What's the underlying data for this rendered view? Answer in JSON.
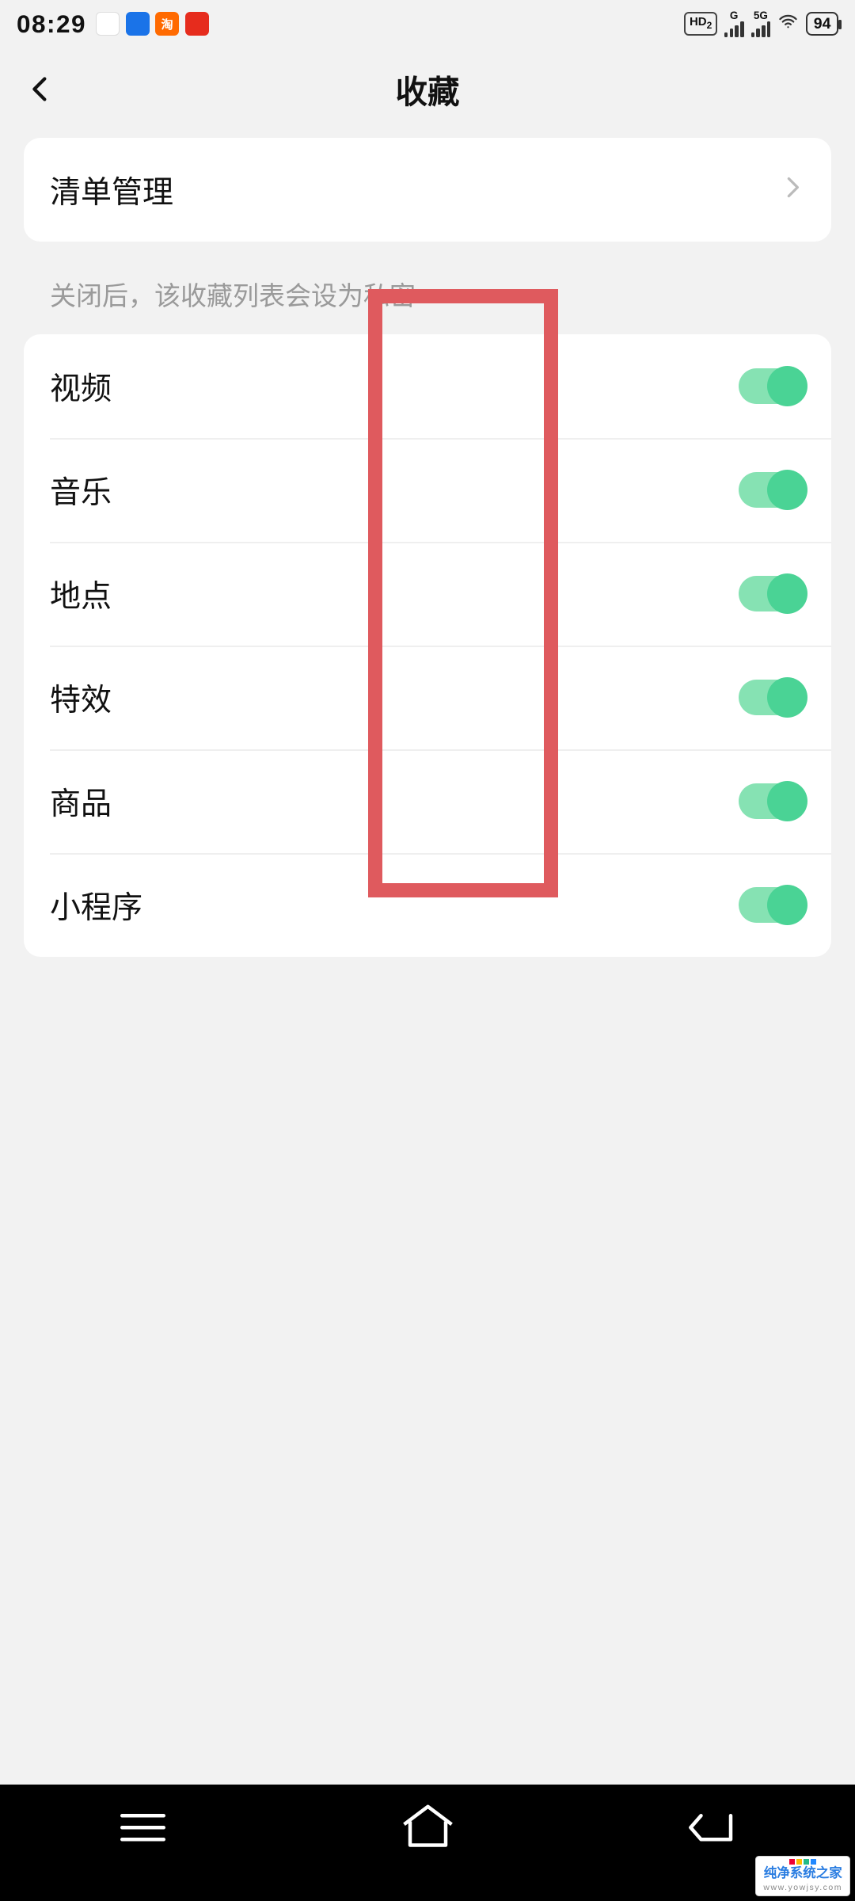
{
  "status_bar": {
    "time": "08:29",
    "hd_label": "HD",
    "hd_sub": "2",
    "g_label": "G",
    "net_label": "5G",
    "battery": "94"
  },
  "header": {
    "title": "收藏"
  },
  "sections": {
    "manage": {
      "label": "清单管理"
    },
    "hint": "关闭后，该收藏列表会设为私密",
    "toggles": [
      {
        "label": "视频",
        "on": true
      },
      {
        "label": "音乐",
        "on": true
      },
      {
        "label": "地点",
        "on": true
      },
      {
        "label": "特效",
        "on": true
      },
      {
        "label": "商品",
        "on": true
      },
      {
        "label": "小程序",
        "on": true
      }
    ]
  },
  "watermark": {
    "title": "纯净系统之家",
    "url": "www.yowjsy.com"
  }
}
